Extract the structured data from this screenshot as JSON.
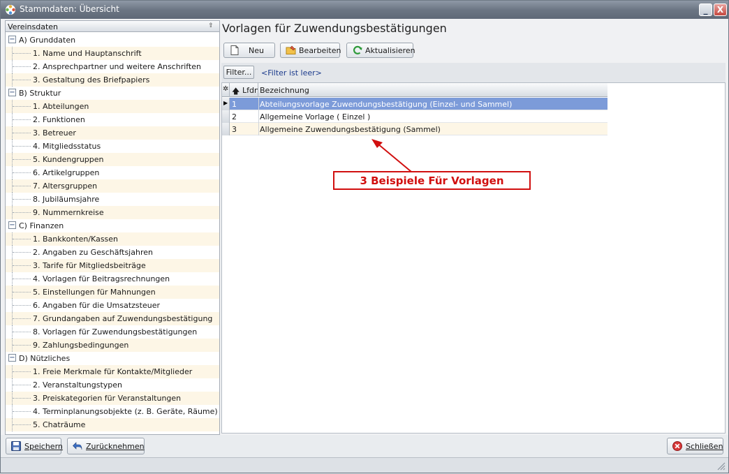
{
  "window": {
    "title": "Stammdaten: Übersicht",
    "minimize_glyph": "_",
    "close_glyph": "X"
  },
  "tree": {
    "header": "Vereinsdaten",
    "pin_glyph": "⇧",
    "groups": [
      {
        "label": "A) Grunddaten",
        "items": [
          "1. Name und Hauptanschrift",
          "2. Ansprechpartner und weitere Anschriften",
          "3. Gestaltung des Briefpapiers"
        ]
      },
      {
        "label": "B) Struktur",
        "items": [
          "1. Abteilungen",
          "2. Funktionen",
          "3. Betreuer",
          "4. Mitgliedsstatus",
          "5. Kundengruppen",
          "6. Artikelgruppen",
          "7. Altersgruppen",
          "8. Jubiläumsjahre",
          "9. Nummernkreise"
        ]
      },
      {
        "label": "C) Finanzen",
        "items": [
          "1. Bankkonten/Kassen",
          "2. Angaben zu Geschäftsjahren",
          "3. Tarife für Mitgliedsbeiträge",
          "4. Vorlagen für Beitragsrechnungen",
          "5. Einstellungen für Mahnungen",
          "6. Angaben für die Umsatzsteuer",
          "7. Grundangaben auf Zuwendungsbestätigung",
          "8. Vorlagen für Zuwendungsbestätigungen",
          "9. Zahlungsbedingungen"
        ]
      },
      {
        "label": "D) Nützliches",
        "items": [
          "1. Freie Merkmale für Kontakte/Mitglieder",
          "2. Veranstaltungstypen",
          "3. Preiskategorien für Veranstaltungen",
          "4. Terminplanungsobjekte (z. B. Geräte, Räume)",
          "5. Chaträume"
        ]
      }
    ]
  },
  "content": {
    "title": "Vorlagen für Zuwendungsbestätigungen",
    "toolbar": {
      "new_label": "Neu",
      "edit_label": "Bearbeiten",
      "refresh_label": "Aktualisieren"
    },
    "filter": {
      "button_label": "Filter...",
      "status": "<Filter ist leer>"
    },
    "grid": {
      "columns": {
        "marker": "✲",
        "sort_arrow": "🡅",
        "nr": "Lfdnr",
        "name": "Bezeichnung"
      },
      "rows": [
        {
          "nr": "1",
          "name": "Abteilungsvorlage Zuwendungsbestätigung (Einzel- und Sammel)"
        },
        {
          "nr": "2",
          "name": "Allgemeine Vorlage ( Einzel )"
        },
        {
          "nr": "3",
          "name": "Allgemeine Zuwendungsbestätigung (Sammel)"
        }
      ],
      "current_row_marker": "▶"
    },
    "annotation": "3 Beispiele Für Vorlagen"
  },
  "bottom": {
    "save_label": "Speichern",
    "undo_label": "Zurücknehmen",
    "close_label": "Schließen"
  },
  "colors": {
    "selected_row": "#7c9bd9",
    "alt_row": "#fdf6e6",
    "annotation": "#d10f0f",
    "titlebar": "#6c7684"
  }
}
